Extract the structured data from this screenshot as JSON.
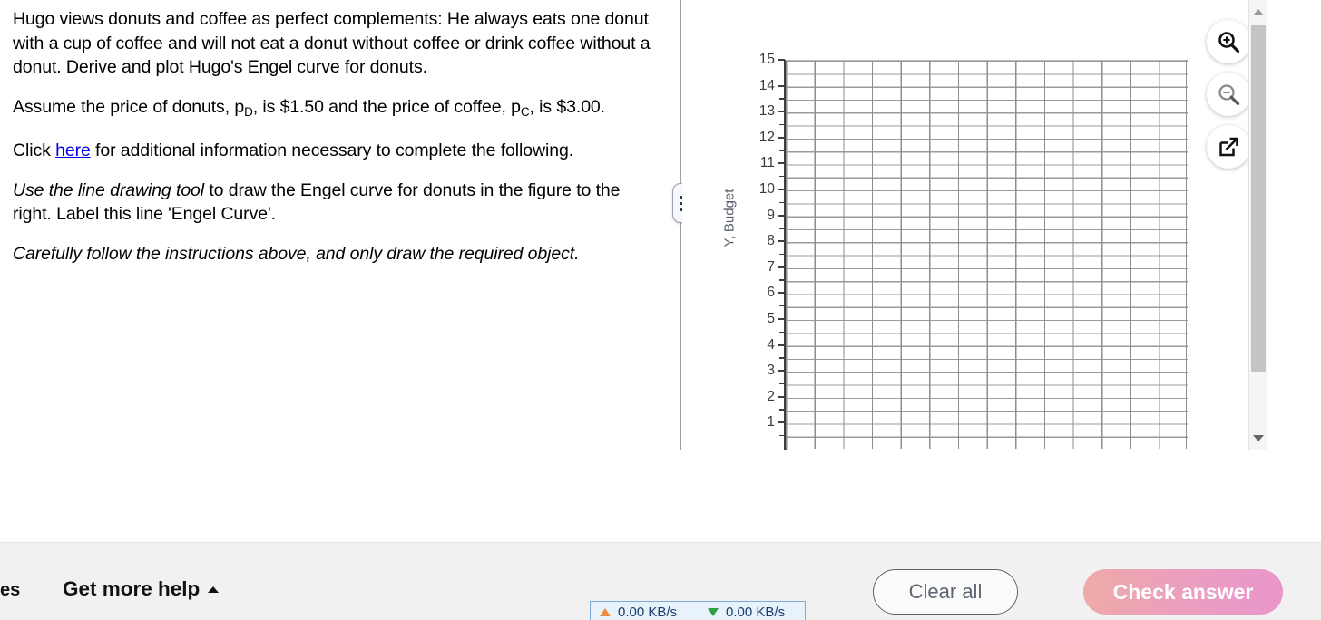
{
  "question": {
    "paragraph1_a": "Hugo views donuts and coffee as perfect complements: He always eats one donut with a cup of coffee and will not eat a donut without coffee or drink coffee without a donut.  Derive and plot Hugo's Engel curve for donuts.",
    "paragraph2_a": "Assume the price of donuts, p",
    "paragraph2_sub1": "D",
    "paragraph2_b": ", is $1.50 and the price of coffee, p",
    "paragraph2_sub2": "C",
    "paragraph2_c": ", is $3.00.",
    "paragraph3_a": "Click ",
    "paragraph3_link": "here",
    "paragraph3_b": " for additional information necessary to complete the following.",
    "paragraph4_italic": "Use the line drawing tool",
    "paragraph4_rest": " to draw the Engel curve for donuts in the figure to the right. Label this line 'Engel Curve'.",
    "paragraph5": "Carefully follow the instructions above, and only draw the required object."
  },
  "chart_data": {
    "type": "line",
    "title": "",
    "xlabel": "",
    "ylabel": "Y, Budget",
    "ylim": [
      0,
      15
    ],
    "xlim": [
      0,
      14
    ],
    "y_tick_labels": [
      "15",
      "14",
      "13",
      "12",
      "11",
      "10",
      "9",
      "8",
      "7",
      "6",
      "5",
      "4",
      "3",
      "2",
      "1"
    ],
    "y_tick_values": [
      15,
      14,
      13,
      12,
      11,
      10,
      9,
      8,
      7,
      6,
      5,
      4,
      3,
      2,
      1
    ],
    "x_tick_labels": [],
    "minor_ticks_per_interval": 1,
    "grid": true,
    "grid_color": "#8e8e8e",
    "series": [],
    "legend": "none",
    "note": "Empty plotting grid for student to draw the Engel curve; x-axis labels are clipped below the visible viewport."
  },
  "graph_tools": {
    "zoom_in_label": "Zoom in",
    "zoom_out_label": "Zoom out",
    "open_label": "Open in new window"
  },
  "scrollbar": {
    "up_label": "Scroll up",
    "down_label": "Scroll down",
    "thumb_label": "Scroll thumb"
  },
  "splitter": {
    "handle_label": "Resize panes"
  },
  "footer": {
    "cut_off_text": "es",
    "get_more_help": "Get more help",
    "clear_all": "Clear all",
    "check_answer": "Check answer"
  },
  "network_monitor": {
    "upload": "0.00 KB/s",
    "download": "0.00 KB/s"
  },
  "colors": {
    "link": "#0000ee",
    "check_answer_start": "#eeaaa6",
    "check_answer_end": "#e995cb",
    "footer_bg": "#f1f1f1",
    "grid": "#8e8e8e",
    "axis": "#3d3d3d",
    "axis_label": "#575f6b"
  }
}
